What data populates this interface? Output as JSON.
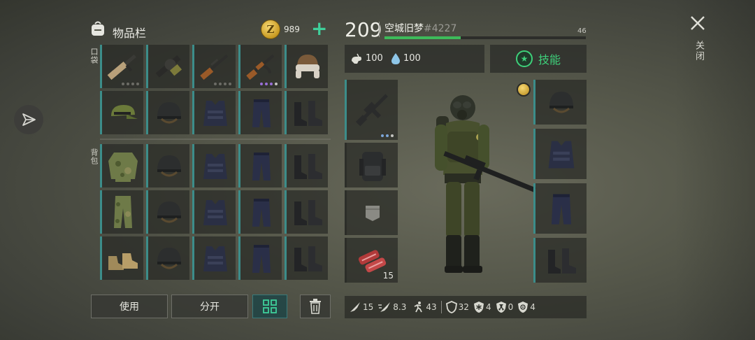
{
  "inventory": {
    "title": "物品栏",
    "coin_symbol": "Z",
    "coins": "989",
    "add_label": "+",
    "pocket_label": "口袋",
    "backpack_label": "背包",
    "pocket_items": [
      "assault-rifle",
      "grenade-launcher",
      "hunting-rifle",
      "ak-rifle",
      "ushanka-hat",
      "camo-cap",
      "tactical-helmet",
      "tactical-vest",
      "tactical-pants",
      "combat-boots"
    ],
    "backpack_items": [
      "camo-jacket",
      "tactical-helmet",
      "tactical-vest",
      "tactical-pants",
      "combat-boots",
      "camo-pants",
      "tactical-helmet",
      "tactical-vest",
      "tactical-pants",
      "combat-boots",
      "tan-boots",
      "tactical-helmet",
      "tactical-vest",
      "tactical-pants",
      "combat-boots"
    ]
  },
  "actions": {
    "use": "使用",
    "split": "分开"
  },
  "character": {
    "level": "209",
    "name": "空城旧梦",
    "id": "#4227",
    "xp_value": "46",
    "xp_fraction": 0.38,
    "hunger": "100",
    "thirst": "100",
    "skills": "技能",
    "meat_count": "15"
  },
  "stats": {
    "attack": "15",
    "attack_speed": "8.3",
    "speed": "43",
    "armor": "32",
    "cold": "4",
    "radiation": "0",
    "bio": "4"
  },
  "close_label": "关闭",
  "colors": {
    "accent_teal": "#3c8d8a",
    "xp_green": "#3dbb5a",
    "plus_green": "#3fcf9a",
    "skill_green": "#3ed07a"
  }
}
